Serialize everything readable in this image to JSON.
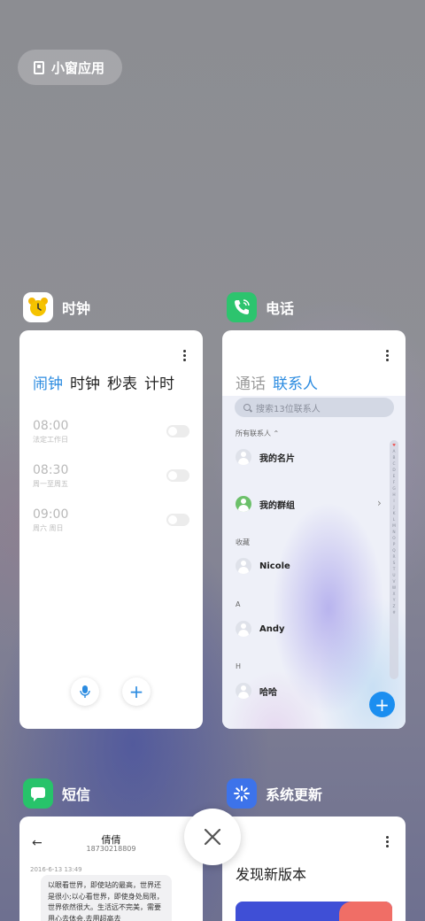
{
  "small_window": {
    "label": "小窗应用",
    "icon": "small-window-icon"
  },
  "cards": {
    "clock": {
      "app_name": "时钟",
      "icon": "alarm-clock-icon",
      "tabs": [
        "闹钟",
        "时钟",
        "秒表",
        "计时"
      ],
      "active_tab": 0,
      "alarms": [
        {
          "time": "08:00",
          "repeat": "法定工作日",
          "enabled": false
        },
        {
          "time": "08:30",
          "repeat": "周一至周五",
          "enabled": false
        },
        {
          "time": "09:00",
          "repeat": "周六 周日",
          "enabled": false
        }
      ]
    },
    "phone": {
      "app_name": "电话",
      "icon": "phone-icon",
      "tabs": [
        "通话",
        "联系人"
      ],
      "active_tab": 1,
      "search_placeholder": "搜索13位联系人",
      "filter_label": "所有联系人",
      "my_card": "我的名片",
      "my_groups": "我的群组",
      "favorites_label": "收藏",
      "favorite_contact": "Nicole",
      "section_a": "A",
      "contact_a": "Andy",
      "section_h": "H",
      "contact_h": "哈哈",
      "index_letters": [
        "♥",
        "A",
        "B",
        "C",
        "D",
        "E",
        "F",
        "G",
        "H",
        "I",
        "J",
        "K",
        "L",
        "M",
        "N",
        "O",
        "P",
        "Q",
        "R",
        "S",
        "T",
        "U",
        "V",
        "W",
        "X",
        "Y",
        "Z",
        "#"
      ]
    },
    "sms": {
      "app_name": "短信",
      "icon": "message-icon",
      "contact_name": "倩倩",
      "contact_number": "18730218809",
      "date": "2016-6-13 13:49",
      "message": "以眼看世界，即使站的最高，世界还是很小;以心看世界，即使身处局限，世界依然很大。生活远不完美，需要用心去体会,去用超高去"
    },
    "update": {
      "app_name": "系统更新",
      "icon": "update-icon",
      "title": "发现新版本"
    }
  },
  "close": {
    "icon": "close-icon"
  }
}
